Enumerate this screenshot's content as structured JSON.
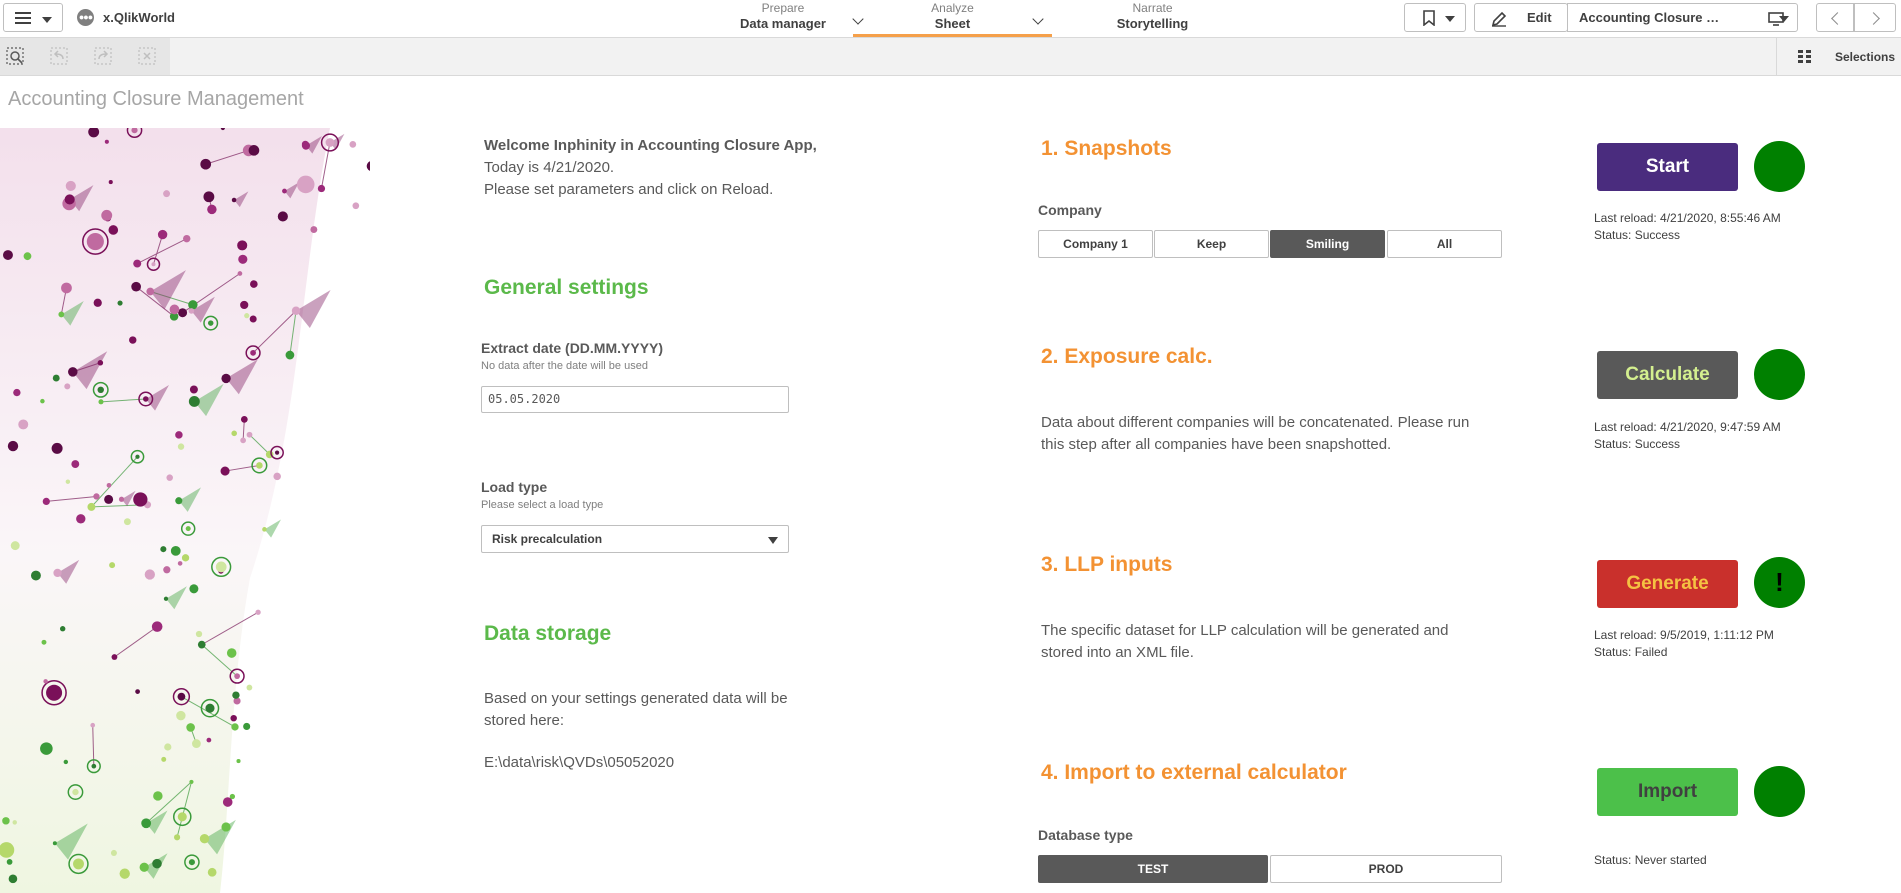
{
  "topbar": {
    "app_name": "x.QlikWorld",
    "tabs": [
      {
        "sub": "Prepare",
        "main": "Data manager"
      },
      {
        "sub": "Analyze",
        "main": "Sheet"
      },
      {
        "sub": "Narrate",
        "main": "Storytelling"
      }
    ],
    "edit_label": "Edit",
    "sheet_title": "Accounting Closure Management",
    "icons": {
      "menu": "hamburger-icon",
      "bookmark": "bookmark-icon",
      "edit": "pencil-icon",
      "sheet": "sheet-display-icon"
    }
  },
  "selection_bar": {
    "selections_label": "Selections"
  },
  "sheet": {
    "heading": "Accounting Closure Management",
    "welcome": {
      "line1": "Welcome Inphinity in Accounting Closure App,",
      "line2": "Today is 4/21/2020.",
      "line3": "Please set parameters and click on Reload."
    },
    "general_settings": {
      "title": "General settings",
      "extract_label": "Extract date (DD.MM.YYYY)",
      "extract_hint": "No data after the date will be used",
      "extract_value": "05.05.2020",
      "load_label": "Load type",
      "load_hint": "Please select a load type",
      "load_value": "Risk precalculation"
    },
    "data_storage": {
      "title": "Data storage",
      "text": "Based on your settings generated data will be stored here:",
      "path": "E:\\data\\risk\\QVDs\\05052020"
    },
    "steps": [
      {
        "title": "1. Snapshots",
        "selector_label": "Company",
        "options": [
          "Company 1",
          "Keep",
          "Smiling",
          "All"
        ],
        "selected": "Smiling",
        "button": "Start",
        "button_bg": "#4a2c7e",
        "button_fg": "#ffffff",
        "status_line1": "Last reload: 4/21/2020, 8:55:46 AM",
        "status_line2": "Status: Success",
        "indicator": "",
        "indicator_color": "#008000"
      },
      {
        "title": "2. Exposure calc.",
        "description": "Data about different companies will be concatenated. Please run this step after all companies have been snapshotted.",
        "button": "Calculate",
        "button_bg": "#595959",
        "button_fg": "#d4ef8f",
        "status_line1": "Last reload: 4/21/2020, 9:47:59 AM",
        "status_line2": "Status: Success",
        "indicator": "",
        "indicator_color": "#008000"
      },
      {
        "title": "3. LLP inputs",
        "description": "The specific dataset for LLP calculation will be generated and stored into an XML file.",
        "button": "Generate",
        "button_bg": "#c9302c",
        "button_fg": "#f5c242",
        "status_line1": "Last reload: 9/5/2019, 1:11:12 PM",
        "status_line2": "Status: Failed",
        "indicator": "!",
        "indicator_color": "#008000"
      },
      {
        "title": "4. Import to external calculator",
        "selector_label": "Database type",
        "options": [
          "TEST",
          "PROD"
        ],
        "selected": "TEST",
        "button": "Import",
        "button_bg": "#4cc04a",
        "button_fg": "#404040",
        "status_line1": "",
        "status_line2": "Status: Never started",
        "indicator": "",
        "indicator_color": "#008000"
      }
    ]
  }
}
